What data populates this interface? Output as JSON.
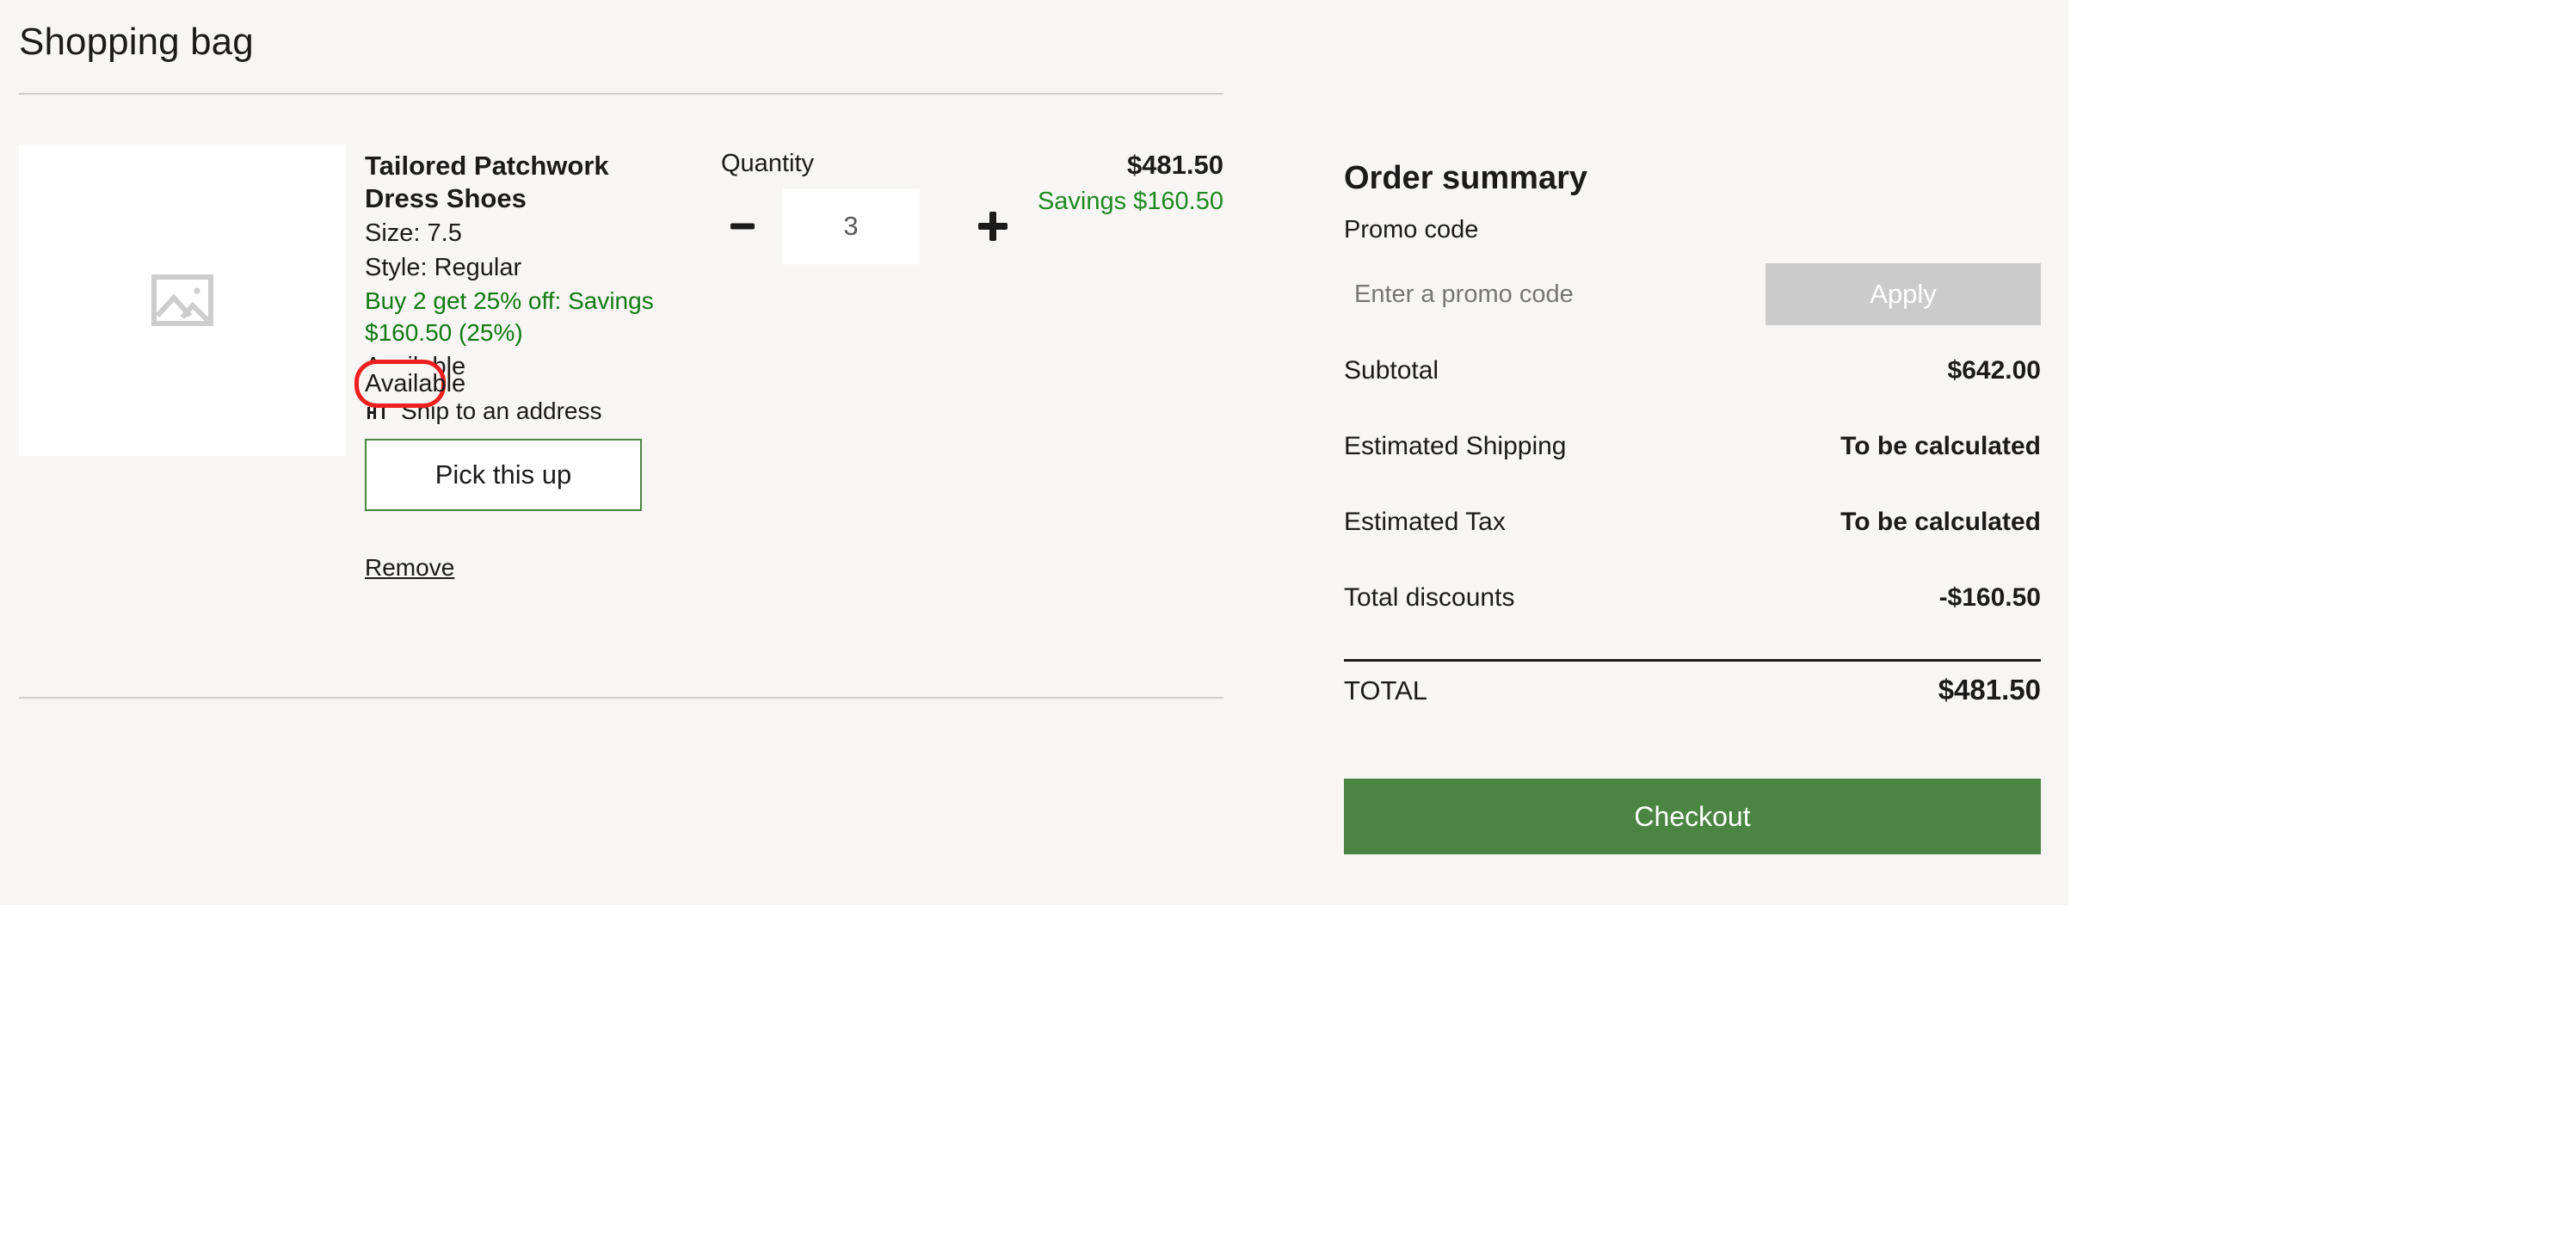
{
  "page": {
    "title": "Shopping bag",
    "background_color": "#f7f6f4",
    "accent_green": "#4a8541",
    "savings_green": "#117a11",
    "annotation_color": "#ee1f1f"
  },
  "cart": {
    "item": {
      "image_placeholder_icon": "broken-image-icon",
      "name": "Tailored Patchwork Dress Shoes",
      "size": "Size: 7.5",
      "style": "Style: Regular",
      "promo": "Buy 2 get 25% off: Savings $160.50 (25%)",
      "availability": "Available",
      "fulfillment_icon": "storefront-icon",
      "fulfillment_label": "Ship to an address",
      "pickup_button": "Pick this up",
      "remove_link": "Remove",
      "quantity_label": "Quantity",
      "quantity_value": "3",
      "decrease_icon": "minus-icon",
      "increase_icon": "plus-icon",
      "line_price": "$481.50",
      "line_savings": "Savings $160.50"
    }
  },
  "summary": {
    "title": "Order summary",
    "promo_label": "Promo code",
    "promo_placeholder": "Enter a promo code",
    "promo_value": "",
    "apply_label": "Apply",
    "rows": [
      {
        "label": "Subtotal",
        "value": "$642.00"
      },
      {
        "label": "Estimated Shipping",
        "value": "To be calculated"
      },
      {
        "label": "Estimated Tax",
        "value": "To be calculated"
      },
      {
        "label": "Total discounts",
        "value": "-$160.50"
      }
    ],
    "total_label": "TOTAL",
    "total_value": "$481.50",
    "checkout_label": "Checkout"
  },
  "annotation": {
    "target": "Available",
    "shape": "rounded-rectangle",
    "color": "#ee1f1f"
  }
}
